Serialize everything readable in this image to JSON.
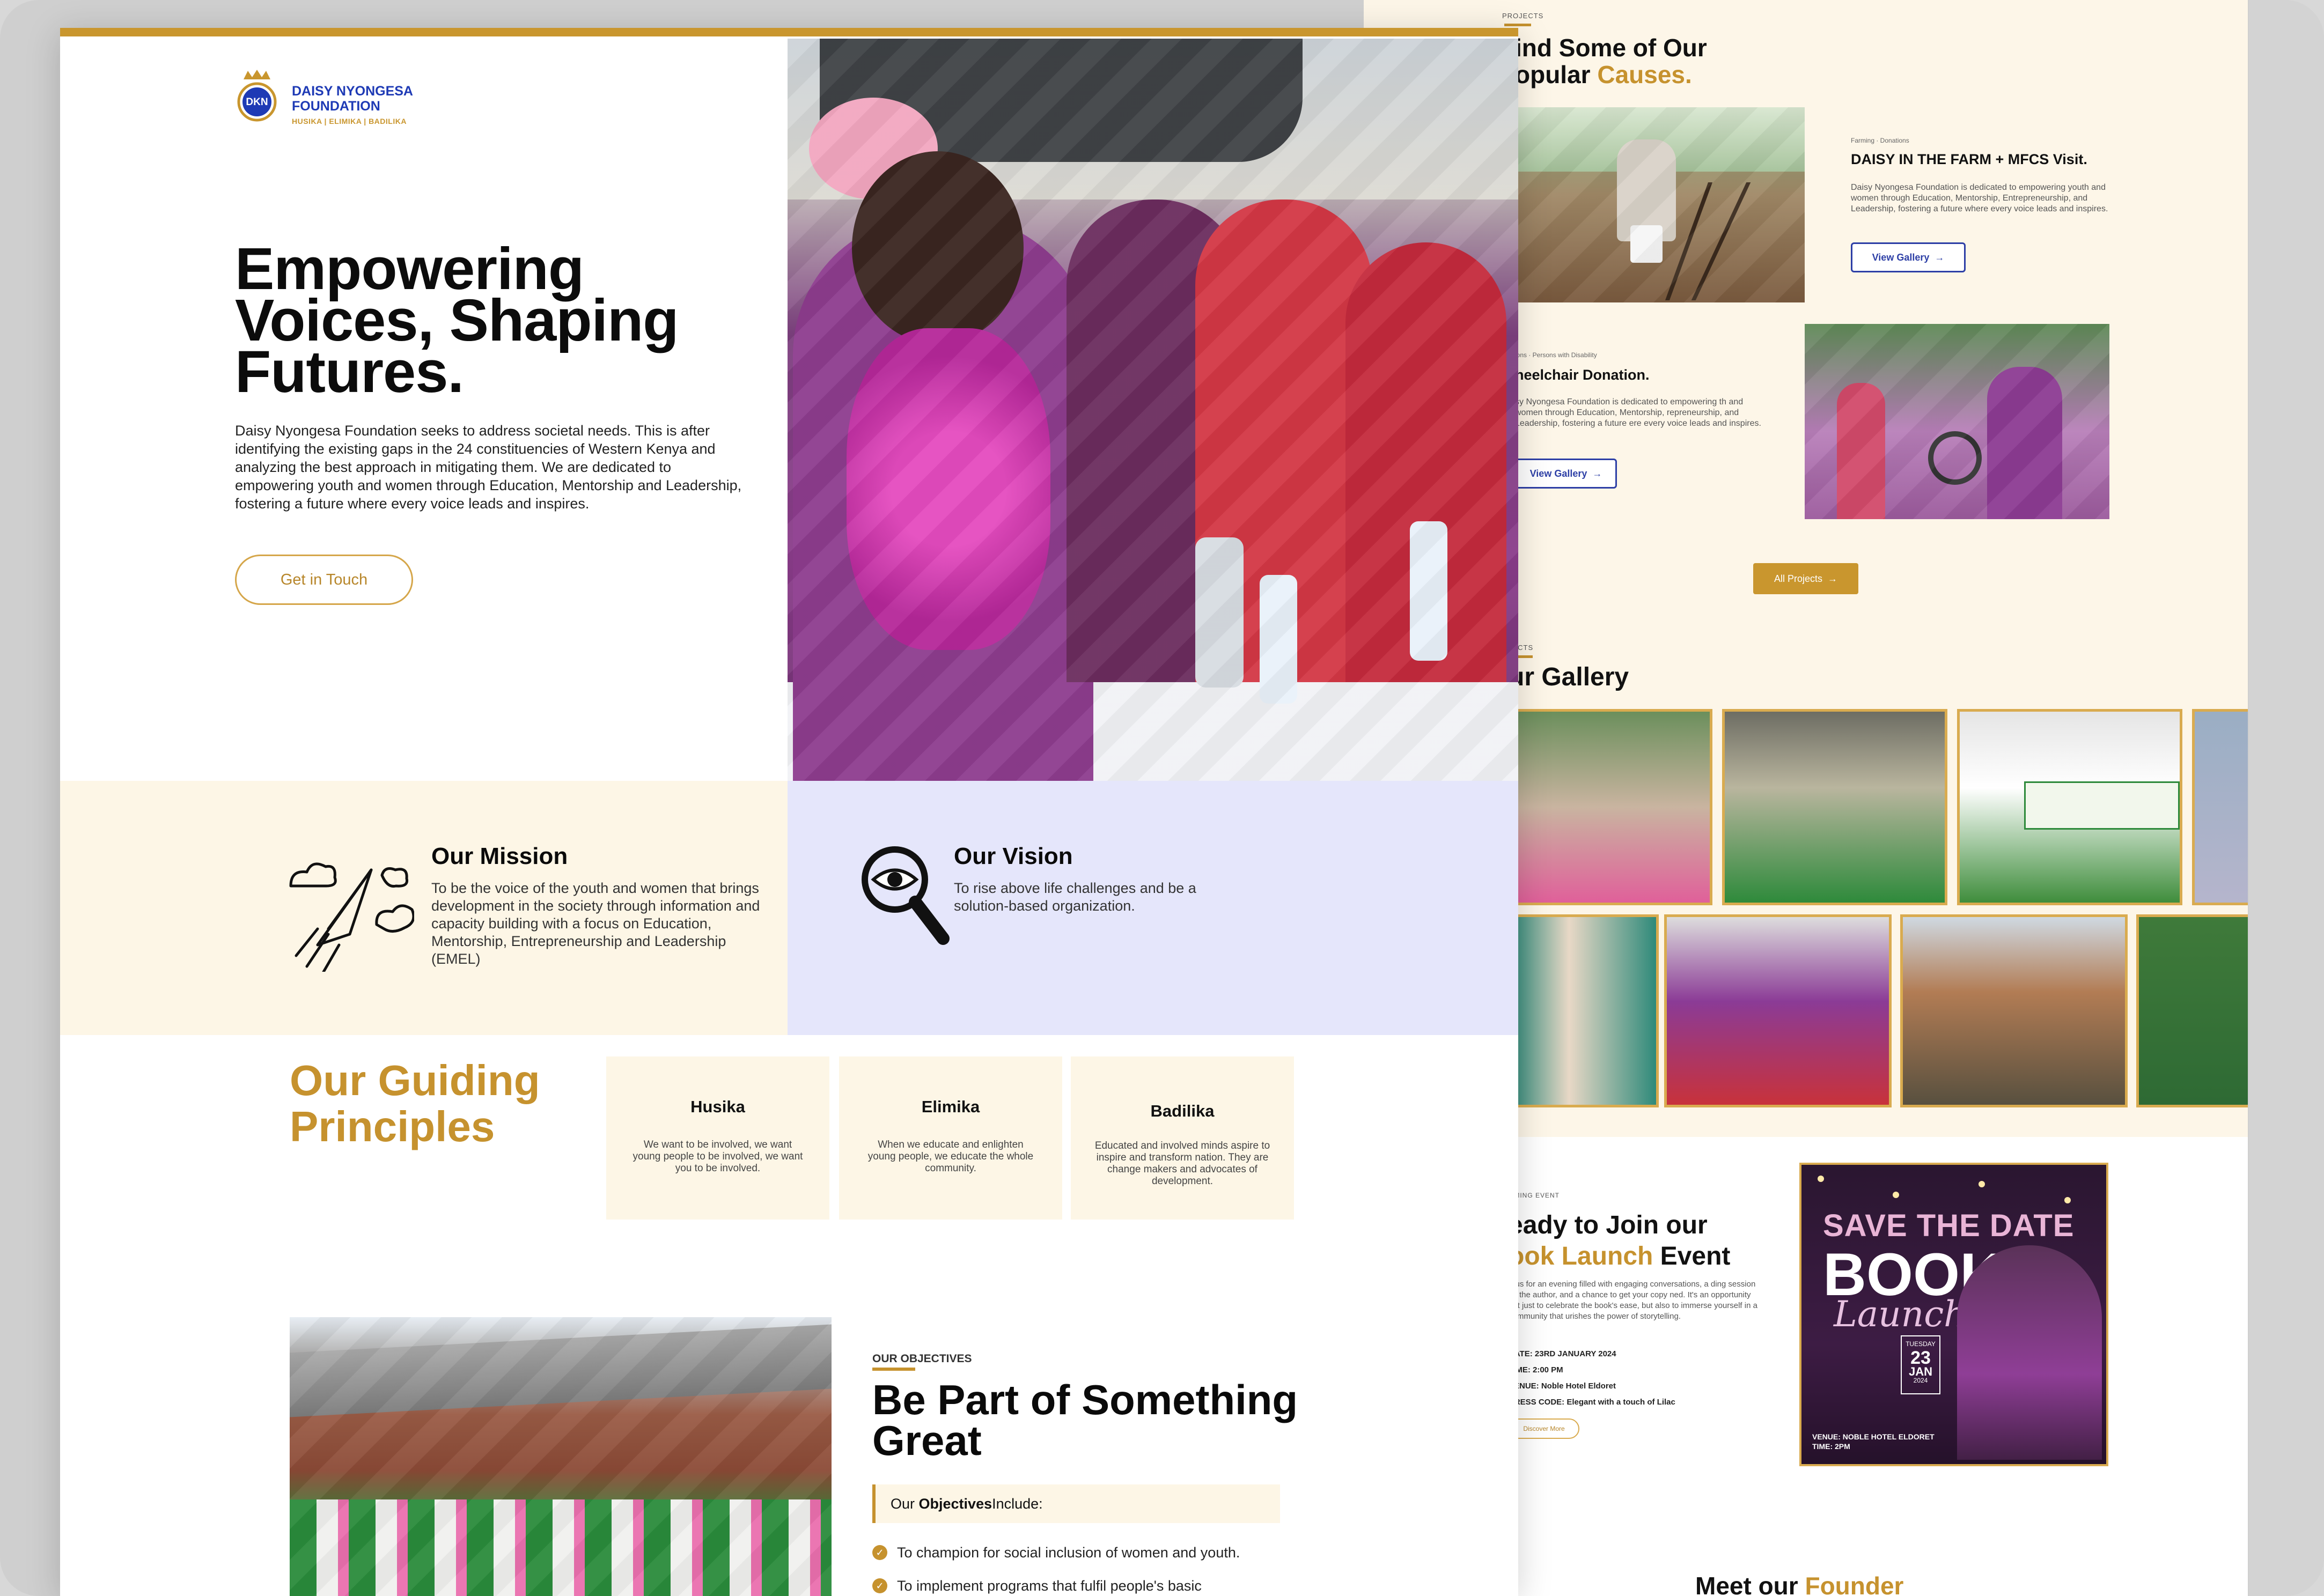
{
  "back": {
    "projects_label": "PROJECTS",
    "heading_line1": "ind Some of Our",
    "heading_line2_a": "opular ",
    "heading_line2_b": "Causes.",
    "cause1": {
      "category": "Farming · Donations",
      "title": "DAISY IN THE FARM + MFCS Visit.",
      "text": "Daisy Nyongesa Foundation is dedicated to empowering youth and women through Education, Mentorship, Entrepreneurship, and Leadership, fostering a future where every voice leads and inspires.",
      "button": "View Gallery"
    },
    "cause2": {
      "category": "ions · Persons with Disability",
      "title": "heelchair Donation.",
      "text": "sy Nyongesa Foundation is dedicated to empowering th and women through Education, Mentorship, repreneurship, and Leadership, fostering a future ere every voice leads and inspires.",
      "button": "View Gallery"
    },
    "all_projects": "All Projects",
    "gallery_label": "JECTS",
    "gallery_title": "ur Gallery",
    "event": {
      "label": "OMING EVENT",
      "title_line1": "eady to Join our",
      "title_line2_a": "ook Launch",
      "title_line2_b": " Event",
      "text": "n us for an evening filled with engaging conversations, a ding session by the author, and a chance to get your copy ned. It's an opportunity not just to celebrate the book's ease, but also to immerse yourself in a community that urishes the power of storytelling.",
      "date": "DATE: 23RD JANUARY 2024",
      "time": "TIME: 2:00 PM",
      "venue": "VENUE: Noble Hotel Eldoret",
      "dress": "DRESS CODE: Elegant with a touch of Lilac",
      "button": "Discover More"
    },
    "poster": {
      "save": "SAVE THE DATE",
      "book": "BOOK",
      "launch": "Launch",
      "day": "TUESDAY",
      "date_num": "23",
      "month": "JAN",
      "year": "2024",
      "venue": "VENUE: NOBLE HOTEL ELDORET",
      "time": "TIME: 2PM"
    },
    "founder_a": "Meet our ",
    "founder_b": "Founder"
  },
  "logo": {
    "mark": "DKN",
    "name_line1": "DAISY NYONGESA",
    "name_line2": "FOUNDATION",
    "tagline": "HUSIKA | ELIMIKA | BADILIKA"
  },
  "hero": {
    "title_line1": "Empowering",
    "title_line2": "Voices, Shaping",
    "title_line3": "Futures.",
    "body": "Daisy Nyongesa Foundation seeks to address societal needs. This is after identifying the existing gaps in the 24 constituencies of Western Kenya and analyzing the best approach in mitigating them. We are dedicated to empowering youth and women through Education, Mentorship and Leadership, fostering a future where every voice leads and inspires.",
    "cta": "Get in Touch"
  },
  "mission": {
    "title": "Our Mission",
    "text": "To be the voice of the youth and women that brings development in the society through information and capacity building with a focus on Education, Mentorship, Entrepreneurship and Leadership (EMEL)"
  },
  "vision": {
    "title": "Our Vision",
    "text": "To rise above life challenges and be a solution-based organization."
  },
  "principles": {
    "title_line1": "Our Guiding",
    "title_line2": "Principles",
    "cards": [
      {
        "title": "Husika",
        "text": "We want to be involved, we want young people to be involved, we want you to be involved."
      },
      {
        "title": "Elimika",
        "text": "When we educate and enlighten young people, we educate the whole community."
      },
      {
        "title": "Badilika",
        "text": "Educated and involved minds aspire to inspire and transform nation. They are change makers and advocates of development."
      }
    ]
  },
  "objectives": {
    "label": "OUR OBJECTIVES",
    "title_line1": "Be Part of Something",
    "title_line2": "Great",
    "box_a": "Our ",
    "box_b": "Objectives",
    "box_c": " Include:",
    "items": [
      "To champion for social inclusion of women and youth.",
      "To implement programs that fulfil people's basic"
    ]
  },
  "colors": {
    "gold": "#c6922e",
    "cream": "#fdf6e6",
    "lavender": "#e5e6fb",
    "blue": "#2d3fa6"
  }
}
